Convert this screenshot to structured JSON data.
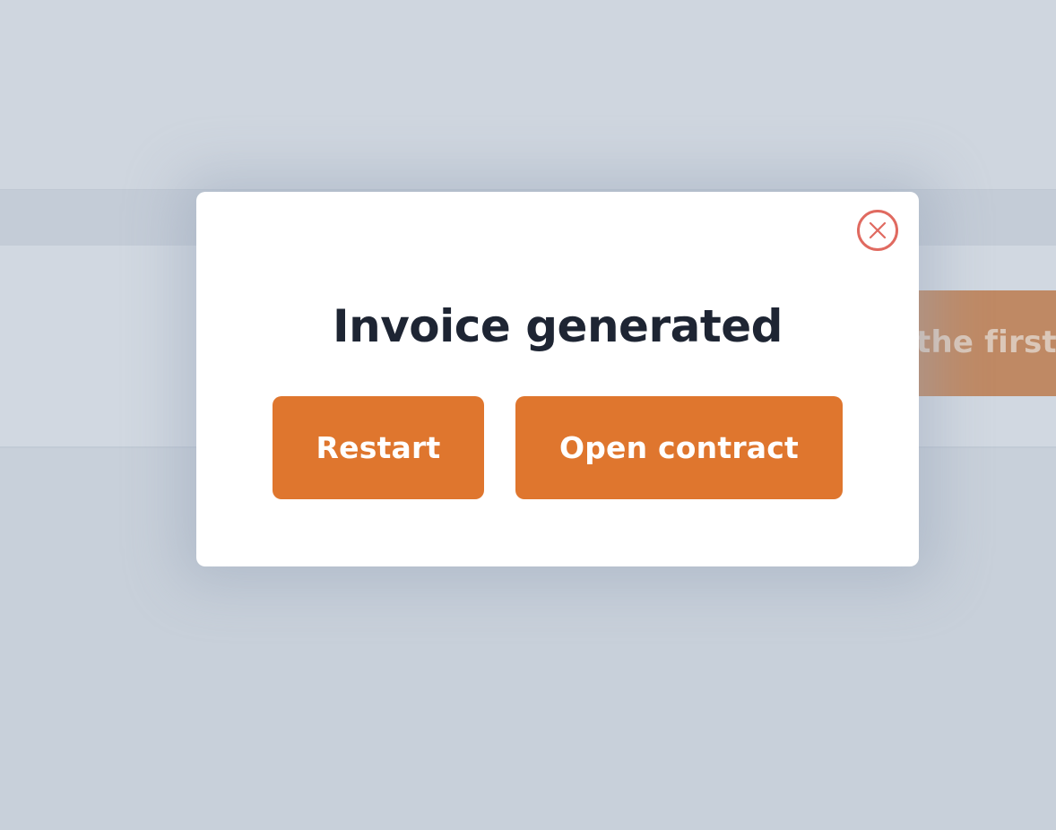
{
  "modal": {
    "title": "Invoice generated",
    "restart_label": "Restart",
    "open_contract_label": "Open contract",
    "close_icon": "close-icon"
  },
  "background": {
    "cta_text": "the first t"
  },
  "colors": {
    "accent": "#df762e",
    "close": "#e06a60",
    "title": "#1e2533"
  }
}
